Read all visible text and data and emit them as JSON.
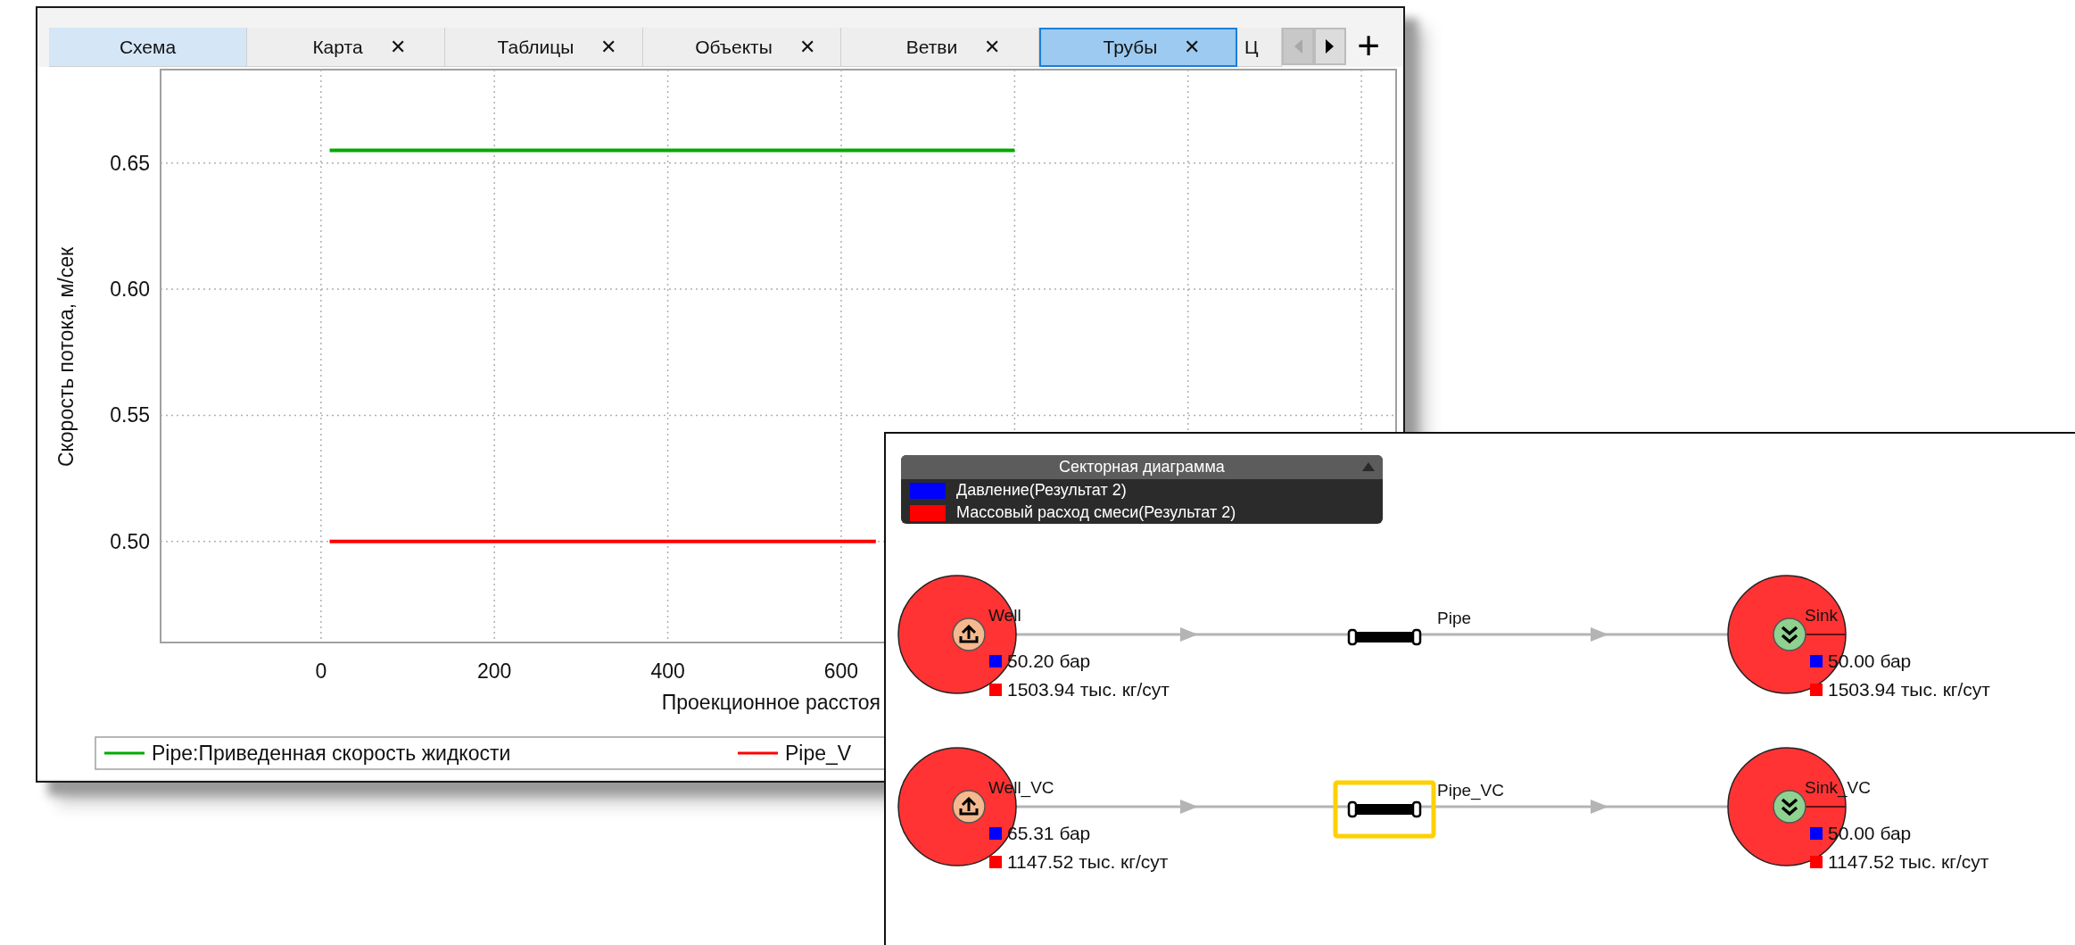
{
  "chart_window": {
    "tabs": [
      {
        "label": "Схема",
        "kind": "home",
        "selected": false
      },
      {
        "label": "Карта",
        "kind": "closable",
        "close": "✕",
        "selected": false
      },
      {
        "label": "Таблицы",
        "kind": "closable",
        "close": "✕",
        "selected": false
      },
      {
        "label": "Объекты",
        "kind": "closable",
        "close": "✕",
        "selected": false
      },
      {
        "label": "Ветви",
        "kind": "closable",
        "close": "✕",
        "selected": false
      },
      {
        "label": "Трубы",
        "kind": "closable",
        "close": "✕",
        "selected": true
      },
      {
        "label": "Ц",
        "kind": "cut",
        "selected": false
      }
    ],
    "new_tab": "+",
    "chart_data": {
      "type": "line",
      "ylabel": "Скорость потока, м/сек",
      "xlabel": "Проекционное расстоя",
      "x": [
        10,
        640,
        800
      ],
      "grid": true,
      "legend": true,
      "xlim": [
        -185,
        1240
      ],
      "ylim": [
        0.46,
        0.687
      ],
      "xticks": [
        0,
        200,
        400,
        600
      ],
      "yticks": [
        {
          "value": 0.5,
          "label": "0.50"
        },
        {
          "value": 0.55,
          "label": "0.55"
        },
        {
          "value": 0.6,
          "label": "0.60"
        },
        {
          "value": 0.65,
          "label": "0.65"
        }
      ],
      "series": [
        {
          "name": "Pipe:Приведенная скорость жидкости",
          "color": "#00aa00",
          "values": [
            0.655,
            0.655,
            0.655
          ]
        },
        {
          "name": "Pipe_V",
          "color": "#ff0000",
          "values": [
            0.5,
            0.5,
            null
          ]
        }
      ]
    }
  },
  "diagram_window": {
    "legend": {
      "title": "Секторная диаграмма",
      "items": [
        {
          "label": "Давление(Результат 2)",
          "color": "#0000ff"
        },
        {
          "label": "Массовый расход смеси(Результат 2)",
          "color": "#ff0000"
        }
      ]
    },
    "chains": [
      {
        "source": {
          "name": "Well",
          "values": [
            "50.20 бар",
            "1503.94 тыс. кг/сут"
          ]
        },
        "pipe": {
          "name": "Pipe",
          "selected": false
        },
        "sink": {
          "name": "Sink",
          "values": [
            "50.00 бар",
            "1503.94 тыс. кг/сут"
          ]
        }
      },
      {
        "source": {
          "name": "Well_VC",
          "values": [
            "65.31 бар",
            "1147.52 тыс. кг/сут"
          ]
        },
        "pipe": {
          "name": "Pipe_VC",
          "selected": true
        },
        "sink": {
          "name": "Sink_VC",
          "values": [
            "50.00 бар",
            "1147.52 тыс. кг/сут"
          ]
        }
      }
    ]
  }
}
